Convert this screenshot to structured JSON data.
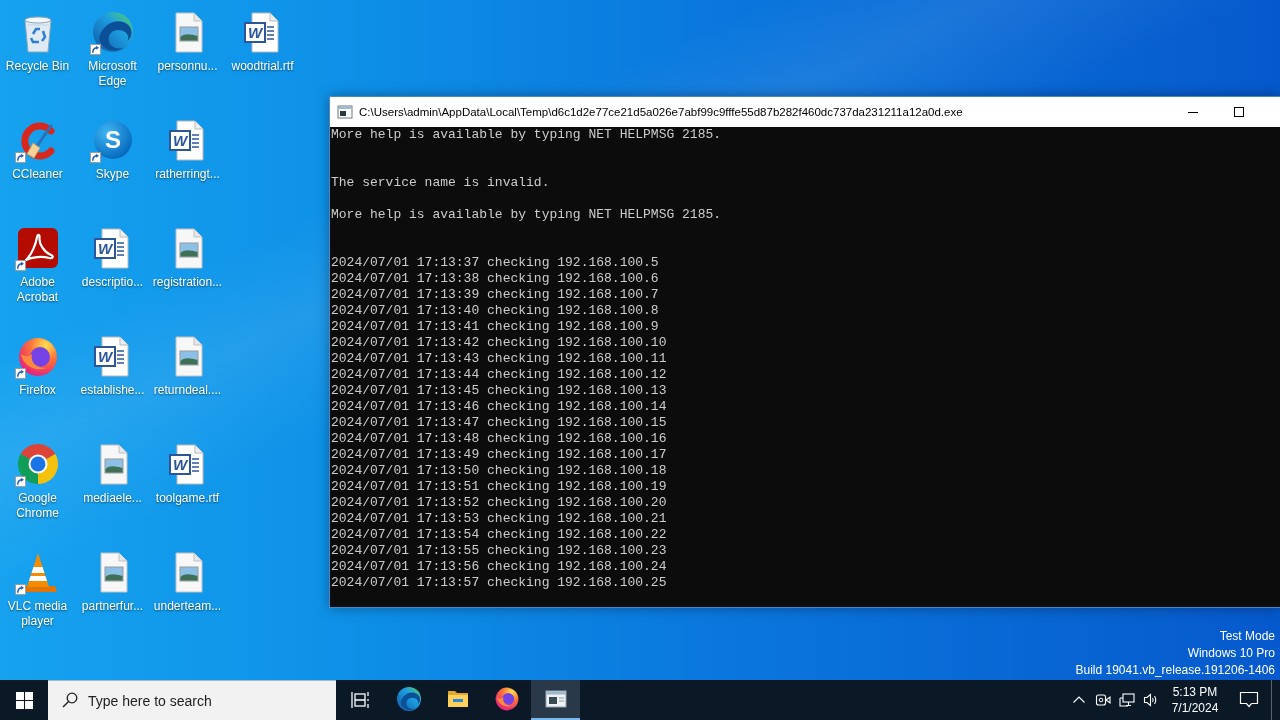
{
  "desktop": {
    "icons": [
      {
        "label": "Recycle Bin",
        "kind": "recycle-bin",
        "shortcut": false
      },
      {
        "label": "CCleaner",
        "kind": "ccleaner",
        "shortcut": true
      },
      {
        "label": "Adobe Acrobat",
        "kind": "acrobat",
        "shortcut": true
      },
      {
        "label": "Firefox",
        "kind": "firefox",
        "shortcut": true
      },
      {
        "label": "Google Chrome",
        "kind": "chrome",
        "shortcut": true
      },
      {
        "label": "VLC media player",
        "kind": "vlc",
        "shortcut": true
      },
      {
        "label": "Microsoft Edge",
        "kind": "edge",
        "shortcut": true
      },
      {
        "label": "Skype",
        "kind": "skype",
        "shortcut": true,
        "mark": "S"
      },
      {
        "label": "descriptio...",
        "kind": "word-doc",
        "shortcut": false,
        "mark": "W"
      },
      {
        "label": "establishe...",
        "kind": "word-doc",
        "shortcut": false,
        "mark": "W"
      },
      {
        "label": "mediaele...",
        "kind": "image-file",
        "shortcut": false
      },
      {
        "label": "partnerfur...",
        "kind": "image-file",
        "shortcut": false
      },
      {
        "label": "personnu...",
        "kind": "image-file",
        "shortcut": false
      },
      {
        "label": "ratherringt...",
        "kind": "word-doc",
        "shortcut": false,
        "mark": "W"
      },
      {
        "label": "registration...",
        "kind": "image-file",
        "shortcut": false
      },
      {
        "label": "returndeal....",
        "kind": "image-file",
        "shortcut": false
      },
      {
        "label": "toolgame.rtf",
        "kind": "word-doc",
        "shortcut": false,
        "mark": "W"
      },
      {
        "label": "underteam...",
        "kind": "image-file",
        "shortcut": false
      },
      {
        "label": "woodtrial.rtf",
        "kind": "word-doc",
        "shortcut": false,
        "mark": "W"
      }
    ],
    "notice": {
      "mode": "Test Mode",
      "edition": "Windows 10 Pro",
      "build": "Build 19041.vb_release.191206-1406"
    }
  },
  "console_window": {
    "title": "C:\\Users\\admin\\AppData\\Local\\Temp\\d6c1d2e77ce21d5a026e7abf99c9fffe55d87b282f460dc737da231211a12a0d.exe",
    "output": [
      {
        "kind": "help",
        "text": "More help is available by typing NET HELPMSG 2185."
      },
      {
        "kind": "status",
        "text": "The service name is invalid."
      },
      {
        "kind": "help",
        "text": "More help is available by typing NET HELPMSG 2185."
      },
      {
        "kind": "log",
        "text": "2024/07/01 17:13:37 checking 192.168.100.5"
      },
      {
        "kind": "log",
        "text": "2024/07/01 17:13:38 checking 192.168.100.6"
      },
      {
        "kind": "log",
        "text": "2024/07/01 17:13:39 checking 192.168.100.7"
      },
      {
        "kind": "log",
        "text": "2024/07/01 17:13:40 checking 192.168.100.8"
      },
      {
        "kind": "log",
        "text": "2024/07/01 17:13:41 checking 192.168.100.9"
      },
      {
        "kind": "log",
        "text": "2024/07/01 17:13:42 checking 192.168.100.10"
      },
      {
        "kind": "log",
        "text": "2024/07/01 17:13:43 checking 192.168.100.11"
      },
      {
        "kind": "log",
        "text": "2024/07/01 17:13:44 checking 192.168.100.12"
      },
      {
        "kind": "log",
        "text": "2024/07/01 17:13:45 checking 192.168.100.13"
      },
      {
        "kind": "log",
        "text": "2024/07/01 17:13:46 checking 192.168.100.14"
      },
      {
        "kind": "log",
        "text": "2024/07/01 17:13:47 checking 192.168.100.15"
      },
      {
        "kind": "log",
        "text": "2024/07/01 17:13:48 checking 192.168.100.16"
      },
      {
        "kind": "log",
        "text": "2024/07/01 17:13:49 checking 192.168.100.17"
      },
      {
        "kind": "log",
        "text": "2024/07/01 17:13:50 checking 192.168.100.18"
      },
      {
        "kind": "log",
        "text": "2024/07/01 17:13:51 checking 192.168.100.19"
      },
      {
        "kind": "log",
        "text": "2024/07/01 17:13:52 checking 192.168.100.20"
      },
      {
        "kind": "log",
        "text": "2024/07/01 17:13:53 checking 192.168.100.21"
      },
      {
        "kind": "log",
        "text": "2024/07/01 17:13:54 checking 192.168.100.22"
      },
      {
        "kind": "log",
        "text": "2024/07/01 17:13:55 checking 192.168.100.23"
      },
      {
        "kind": "log",
        "text": "2024/07/01 17:13:56 checking 192.168.100.24"
      },
      {
        "kind": "log",
        "text": "2024/07/01 17:13:57 checking 192.168.100.25"
      }
    ]
  },
  "taskbar": {
    "search": {
      "placeholder": "Type here to search"
    },
    "apps": [
      {
        "kind": "edge",
        "active": false
      },
      {
        "kind": "explorer",
        "active": false
      },
      {
        "kind": "firefox",
        "active": false
      },
      {
        "kind": "console",
        "active": true
      }
    ],
    "clock": {
      "time": "5:13 PM",
      "date": "7/1/2024"
    }
  }
}
